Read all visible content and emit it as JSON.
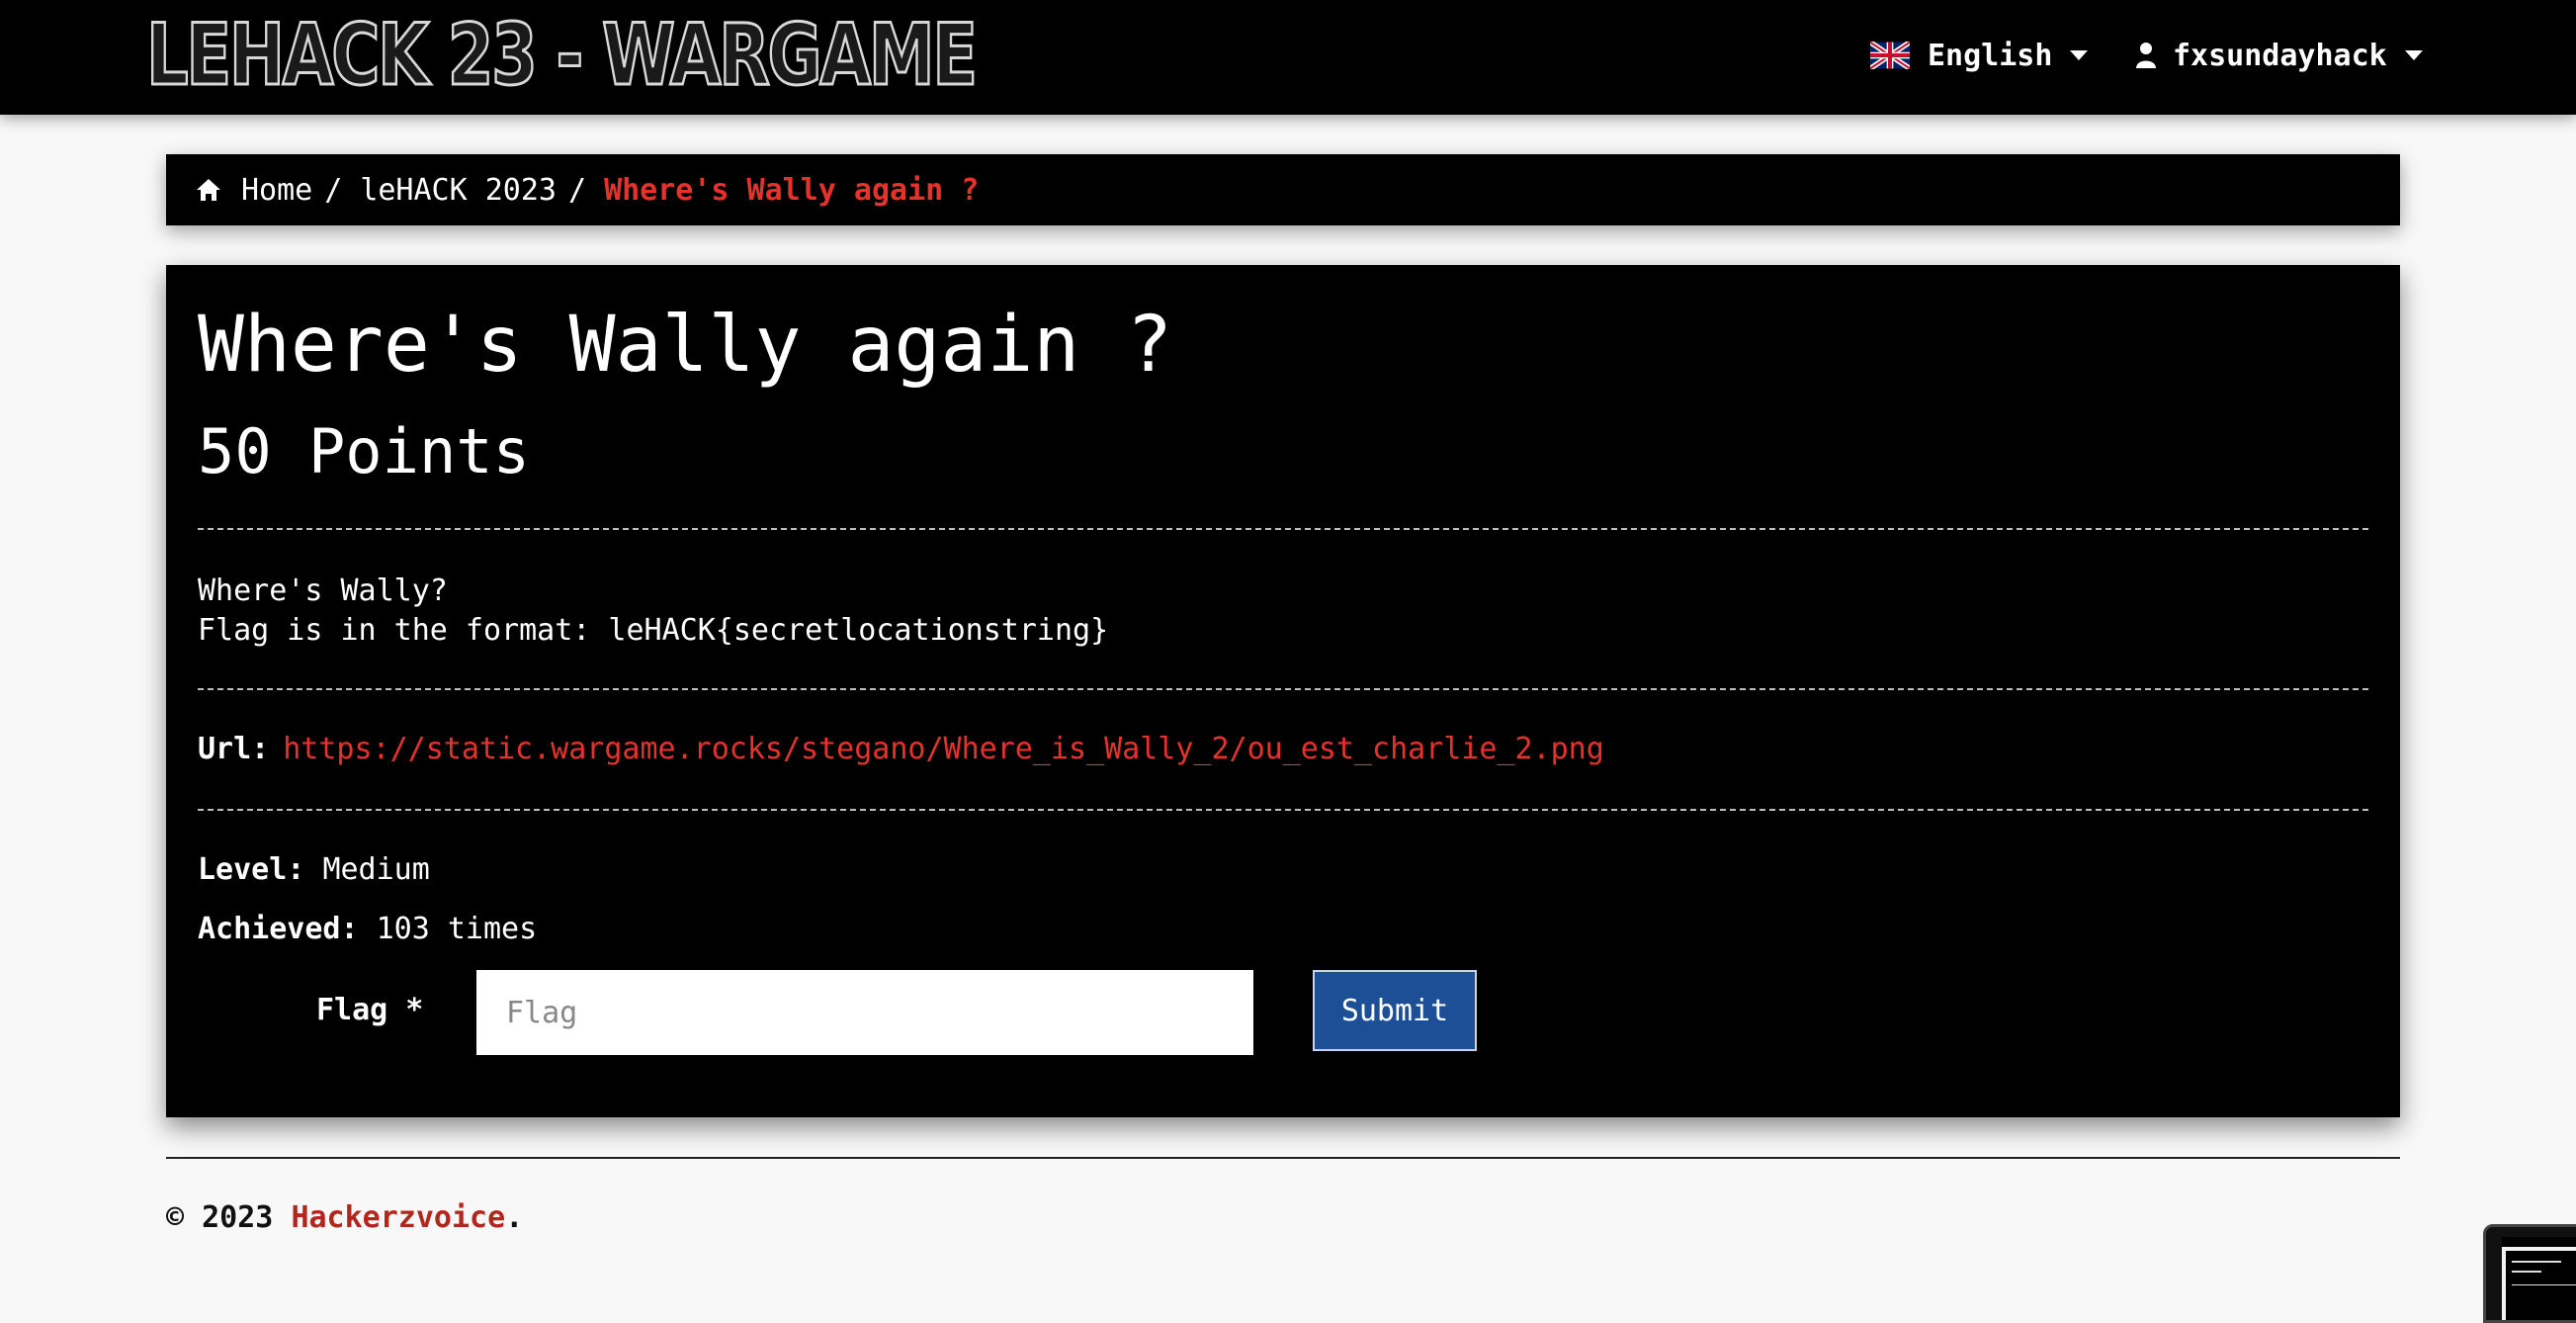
{
  "navbar": {
    "logo": "LEHACK 23 - WARGAME",
    "language": "English",
    "username": "fxsundayhack"
  },
  "breadcrumb": {
    "home": "Home",
    "section": "leHACK 2023",
    "current": "Where's Wally again ?",
    "separator": "/"
  },
  "challenge": {
    "title": "Where's Wally again ?",
    "points": "50 Points",
    "description_line1": "Where's Wally?",
    "description_line2": "Flag is in the format: leHACK{secretlocationstring}",
    "url_label": "Url:",
    "url": "https://static.wargame.rocks/stegano/Where_is_Wally_2/ou_est_charlie_2.png",
    "level_label": "Level:",
    "level": "Medium",
    "achieved_label": "Achieved:",
    "achieved": "103 times"
  },
  "form": {
    "flag_label": "Flag *",
    "flag_placeholder": "Flag",
    "submit_label": "Submit"
  },
  "footer": {
    "copyright": "© 2023",
    "company": "Hackerzvoice",
    "suffix": "."
  },
  "colors": {
    "accent_red": "#e8312b",
    "submit_blue": "#1d4f96",
    "background": "#f8f8f8",
    "panel": "#000000"
  },
  "icons": {
    "language": "uk-flag-icon",
    "user": "user-icon",
    "home": "home-icon",
    "dropdown": "caret-down-icon"
  }
}
